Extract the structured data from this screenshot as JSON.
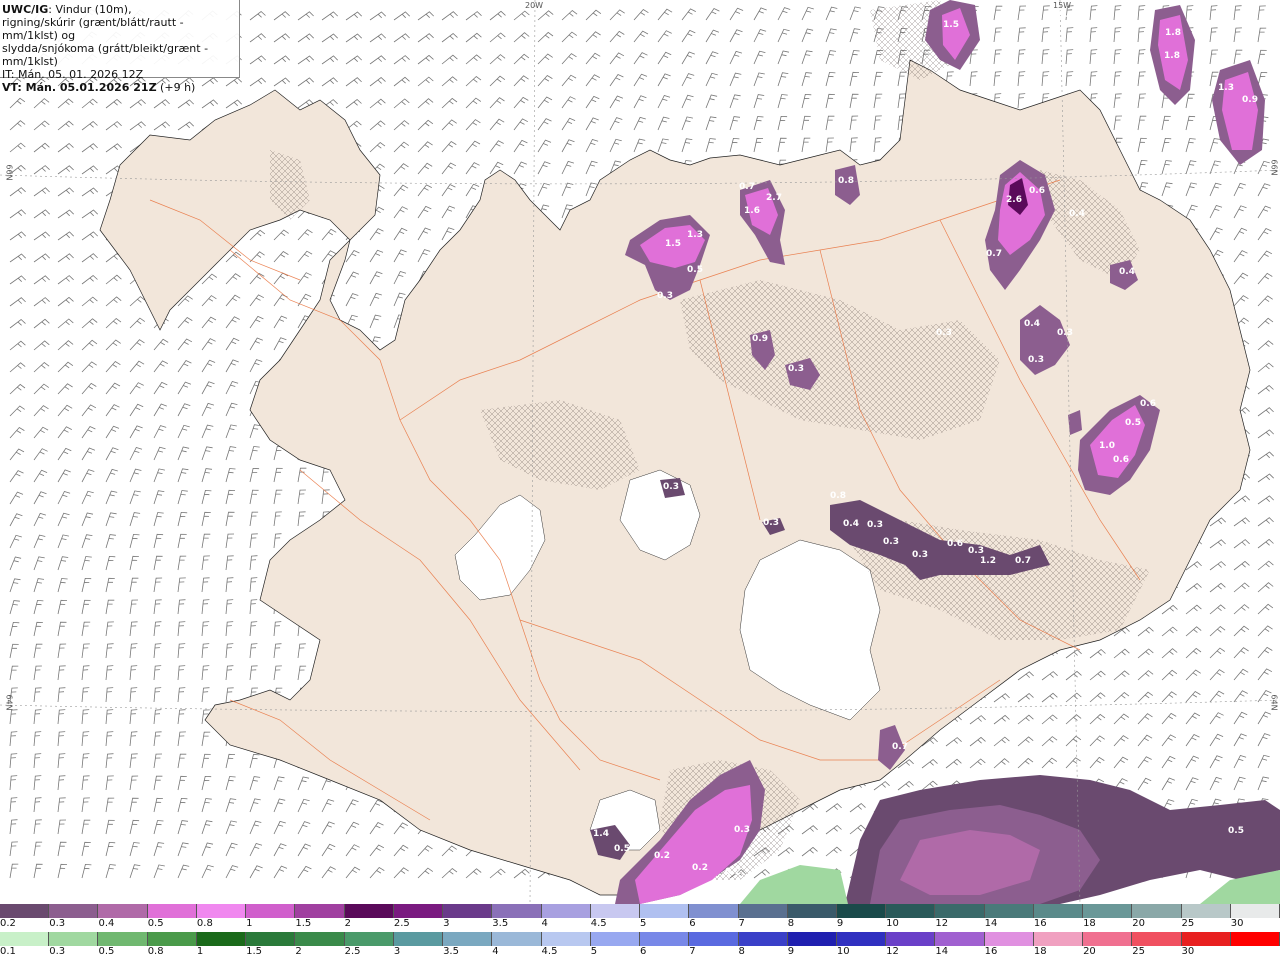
{
  "header": {
    "model": "UWC/IG",
    "line1_rest": ": Vindur (10m),",
    "line2": "rigning/skúrir (grænt/blátt/rautt - mm/1klst) og",
    "line3": "slydda/snjókoma (grátt/bleikt/grænt - mm/1klst)",
    "it": "IT: Mán. 05. 01. 2026 12Z",
    "vt_bold": "VT: Mán. 05.01.2026 21Z",
    "vt_rest": " (+9 h)"
  },
  "grid_labels": {
    "top_20w": "20W",
    "top_15w": "15W",
    "left_66n": "66N",
    "left_64n": "64N",
    "right_66n": "66N",
    "right_64n": "64N"
  },
  "precip_labels": [
    "1.5",
    "1.2",
    "1.8",
    "1.8",
    "1.3",
    "0.9",
    "0.7",
    "1.6",
    "2.7",
    "0.8",
    "1.5",
    "1.3",
    "0.5",
    "0.3",
    "0.9",
    "2.6",
    "0.6",
    "0.4",
    "0.7",
    "0.4",
    "0.3",
    "0.4",
    "0.3",
    "0.3",
    "0.3",
    "0.6",
    "0.5",
    "1.0",
    "0.6",
    "0.8",
    "0.3",
    "0.3",
    "0.4",
    "0.3",
    "0.3",
    "0.3",
    "0.6",
    "0.3",
    "1.2",
    "0.7",
    "0.7",
    "1.4",
    "0.5",
    "0.3",
    "0.2",
    "0.2",
    "0.2",
    "0.5"
  ],
  "scale_top": {
    "labels": [
      "0.2",
      "0.3",
      "0.4",
      "0.5",
      "0.8",
      "1",
      "1.5",
      "2",
      "2.5",
      "3",
      "3.5",
      "4",
      "4.5",
      "5",
      "6",
      "7",
      "8",
      "9",
      "10",
      "12",
      "14",
      "16",
      "18",
      "20",
      "25",
      "30"
    ],
    "colors": [
      "#6a4a6f",
      "#8c5e8f",
      "#b06aa8",
      "#e070d8",
      "#f088ef",
      "#d05fcc",
      "#a040a0",
      "#5a0a5a",
      "#7a1a80",
      "#6a3a8a",
      "#8a70b8",
      "#a8a0e0",
      "#c8c8f0",
      "#b0c0f0",
      "#8090d0",
      "#5a7090",
      "#3a5a6a",
      "#1a4a4a",
      "#2a5a5a",
      "#3a6a6a",
      "#4a7a7a",
      "#5a8a8a",
      "#6a9898",
      "#8aa8a8",
      "#b8c8c8",
      "#e8eaea"
    ]
  },
  "scale_bottom": {
    "labels": [
      "0.1",
      "0.3",
      "0.5",
      "0.8",
      "1",
      "1.5",
      "2",
      "2.5",
      "3",
      "3.5",
      "4",
      "4.5",
      "5",
      "6",
      "7",
      "8",
      "9",
      "10",
      "12",
      "14",
      "16",
      "18",
      "20",
      "25",
      "30"
    ],
    "colors": [
      "#c8f0c8",
      "#a0d8a0",
      "#70b870",
      "#4a9a4a",
      "#1a6a1a",
      "#2a7a3a",
      "#3a8a4a",
      "#4a9a6a",
      "#5a9aa0",
      "#7aa8c0",
      "#9ab8d8",
      "#b8c8f0",
      "#98a8f0",
      "#7888e8",
      "#5a6ae0",
      "#3a40c8",
      "#2020b0",
      "#3030c0",
      "#6a40c8",
      "#a060d0",
      "#e090e0",
      "#f0a0c0",
      "#f07090",
      "#f05060",
      "#e82020",
      "#ff0000"
    ]
  }
}
